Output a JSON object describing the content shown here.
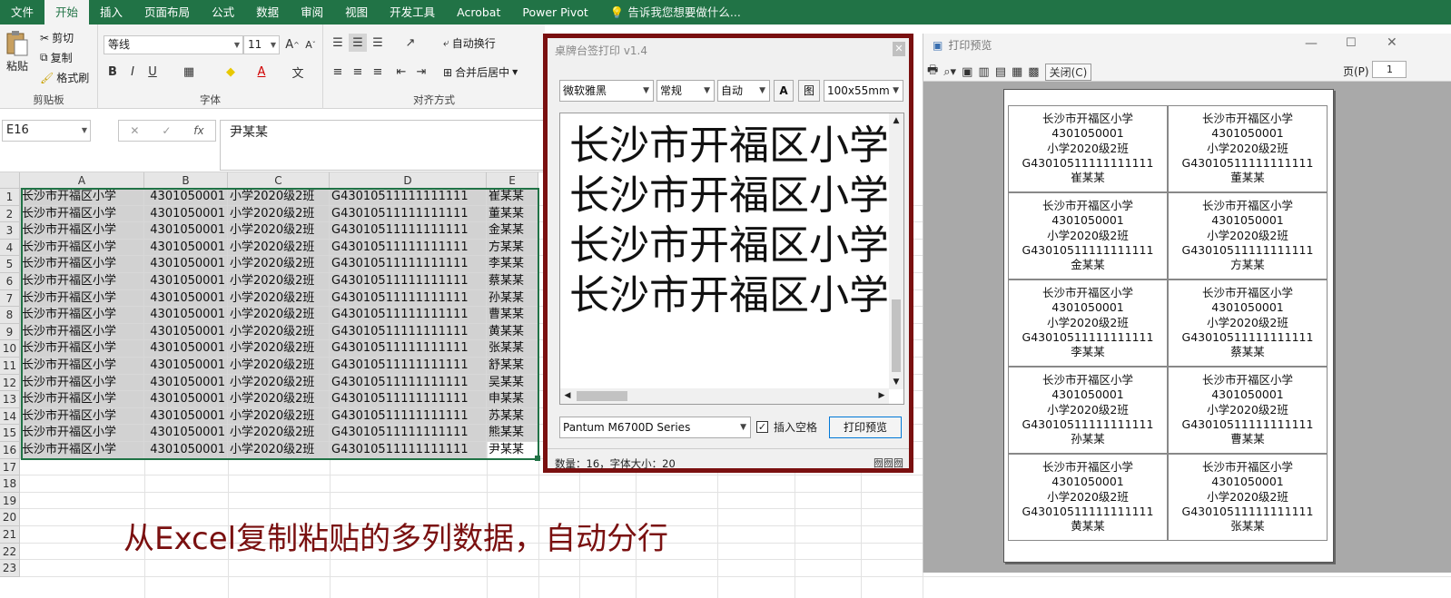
{
  "menu": {
    "items": [
      "文件",
      "开始",
      "插入",
      "页面布局",
      "公式",
      "数据",
      "审阅",
      "视图",
      "开发工具",
      "Acrobat",
      "Power Pivot"
    ],
    "active_index": 1,
    "tell_me": "告诉我您想要做什么..."
  },
  "ribbon": {
    "clipboard": {
      "paste": "粘贴",
      "cut": "剪切",
      "copy": "复制",
      "format_painter": "格式刷",
      "label": "剪贴板"
    },
    "font": {
      "name": "等线",
      "size": "11",
      "label": "字体",
      "bold": "B",
      "italic": "I",
      "underline": "U"
    },
    "align": {
      "wrap": "自动换行",
      "merge": "合并后居中",
      "label": "对齐方式"
    }
  },
  "formula_bar": {
    "cell_ref": "E16",
    "value": "尹某某",
    "fx": "fx"
  },
  "sheet": {
    "columns": [
      "A",
      "B",
      "C",
      "D",
      "E"
    ],
    "row_numbers": [
      "1",
      "2",
      "3",
      "4",
      "5",
      "6",
      "7",
      "8",
      "9",
      "10",
      "11",
      "12",
      "13",
      "14",
      "15",
      "16",
      "17",
      "18",
      "19",
      "20",
      "21",
      "22",
      "23"
    ],
    "school": "长沙市开福区小学",
    "code": "4301050001",
    "class_name": "小学2020级2班",
    "student_id": "G43010511111111111",
    "names": [
      "崔某某",
      "董某某",
      "金某某",
      "方某某",
      "李某某",
      "蔡某某",
      "孙某某",
      "曹某某",
      "黄某某",
      "张某某",
      "舒某某",
      "吴某某",
      "申某某",
      "苏某某",
      "熊某某",
      "尹某某"
    ]
  },
  "label_window": {
    "title": "桌牌台签打印 v1.4",
    "font_select": "微软雅黑",
    "style_select": "常规",
    "size_select": "自动",
    "btn_font": "A",
    "btn_image": "图",
    "paper_select": "100x55mm",
    "preview_lines": [
      "长沙市开福区小学",
      "长沙市开福区小学",
      "长沙市开福区小学",
      "长沙市开福区小学"
    ],
    "printer": "Pantum M6700D Series",
    "insert_space": "插入空格",
    "print_preview_button": "打印预览",
    "status": "数量：16，字体大小：20",
    "corner_icons": "囫囫囫"
  },
  "preview_window": {
    "title": "打印预览",
    "close_button": "关闭(C)",
    "page_label": "页(P)",
    "page_value": "1",
    "labels": [
      [
        "长沙市开福区小学",
        "4301050001",
        "小学2020级2班",
        "G43010511111111111",
        "崔某某"
      ],
      [
        "长沙市开福区小学",
        "4301050001",
        "小学2020级2班",
        "G43010511111111111",
        "董某某"
      ],
      [
        "长沙市开福区小学",
        "4301050001",
        "小学2020级2班",
        "G43010511111111111",
        "金某某"
      ],
      [
        "长沙市开福区小学",
        "4301050001",
        "小学2020级2班",
        "G43010511111111111",
        "方某某"
      ],
      [
        "长沙市开福区小学",
        "4301050001",
        "小学2020级2班",
        "G43010511111111111",
        "李某某"
      ],
      [
        "长沙市开福区小学",
        "4301050001",
        "小学2020级2班",
        "G43010511111111111",
        "蔡某某"
      ],
      [
        "长沙市开福区小学",
        "4301050001",
        "小学2020级2班",
        "G43010511111111111",
        "孙某某"
      ],
      [
        "长沙市开福区小学",
        "4301050001",
        "小学2020级2班",
        "G43010511111111111",
        "曹某某"
      ],
      [
        "长沙市开福区小学",
        "4301050001",
        "小学2020级2班",
        "G43010511111111111",
        "黄某某"
      ],
      [
        "长沙市开福区小学",
        "4301050001",
        "小学2020级2班",
        "G43010511111111111",
        "张某某"
      ]
    ]
  },
  "caption": "从Excel复制粘贴的多列数据，自动分行",
  "colors": {
    "excel_green": "#217346",
    "frame_red": "#7a1010"
  }
}
